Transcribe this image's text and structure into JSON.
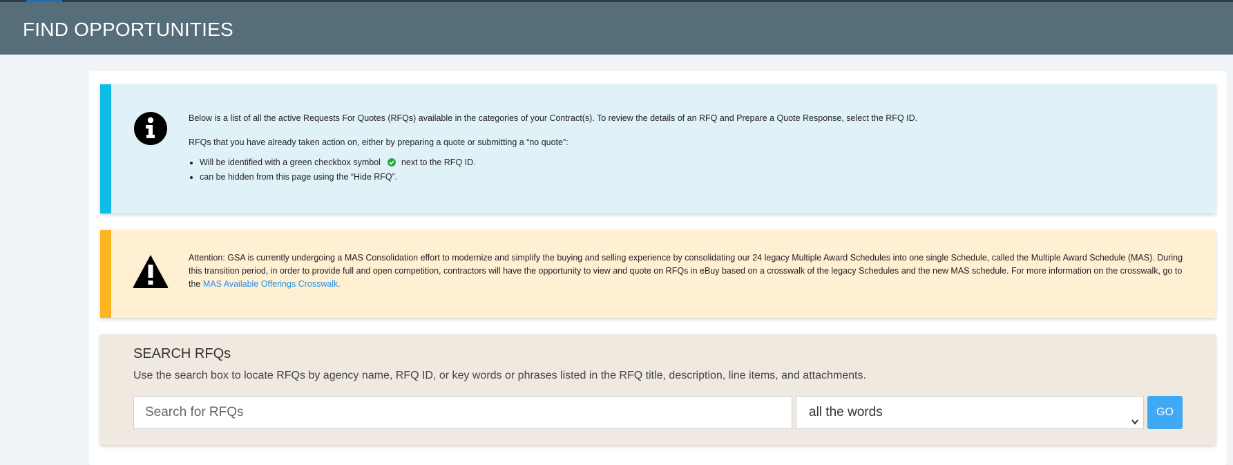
{
  "header": {
    "title": "FIND OPPORTUNITIES"
  },
  "info_alert": {
    "icon": "info-circle-icon",
    "paragraph1": "Below is a list of all the active Requests For Quotes (RFQs) available in the categories of your Contract(s). To review the details of an RFQ and Prepare a Quote Response, select the RFQ ID.",
    "paragraph2": "RFQs that you have already taken action on, either by preparing a quote or submitting a “no quote”:",
    "bullet1_before": "Will be identified with a green checkbox symbol",
    "bullet1_icon": "green-check-circle-icon",
    "bullet1_after": "next to the RFQ ID.",
    "bullet2": "can be hidden from this page using the “Hide RFQ”."
  },
  "warning_alert": {
    "icon": "warning-triangle-icon",
    "text": "Attention: GSA is currently undergoing a MAS Consolidation effort to modernize and simplify the buying and selling experience by consolidating our 24 legacy Multiple Award Schedules into one single Schedule, called the Multiple Award Schedule (MAS). During this transition period, in order to provide full and open competition, contractors will have the opportunity to view and quote on RFQs in eBuy based on a crosswalk of the legacy Schedules and the new MAS schedule. For more information on the crosswalk, go to the",
    "link_text": "MAS Available Offerings Crosswalk."
  },
  "search": {
    "title": "SEARCH RFQs",
    "description": "Use the search box to locate RFQs by agency name, RFQ ID, or key words or phrases listed in the RFQ title, description, line items, and attachments.",
    "placeholder": "Search for RFQs",
    "input_value": "",
    "match_mode_selected": "all the words",
    "go_label": "GO"
  },
  "colors": {
    "header_bg": "#566e7a",
    "info_bar": "#0ebde5",
    "info_bg": "#e1f1f8",
    "warning_bar": "#fdb522",
    "warning_bg": "#fff0d3",
    "search_bg": "#efe9df",
    "go_button": "#3fa9f5",
    "link": "#2a8ee6",
    "check_green": "#28a745"
  }
}
